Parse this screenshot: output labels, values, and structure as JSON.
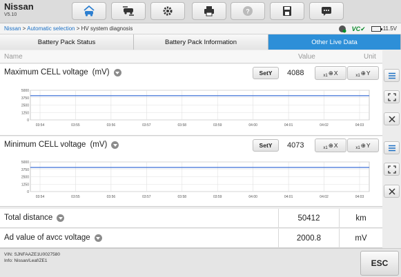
{
  "app": {
    "name": "Nissan",
    "version": "V5.10"
  },
  "toolbar": {
    "icons": [
      "home-car-icon",
      "vehicle-swap-icon",
      "settings-icon",
      "print-icon",
      "help-icon",
      "save-icon",
      "message-icon"
    ]
  },
  "breadcrumb": {
    "link1": "Nissan",
    "sep": " > ",
    "link2": "Automatic selection",
    "current": " > HV system diagnosis"
  },
  "status": {
    "vci": "VC",
    "battery": "11.5V"
  },
  "tabs": [
    "Battery Pack Status",
    "Battery Pack Information",
    "Other Live Data"
  ],
  "active_tab": 2,
  "header": {
    "name": "Name",
    "value": "Value",
    "unit": "Unit"
  },
  "buttons": {
    "sety": "SetY",
    "zoom_x": "X",
    "zoom_y": "Y",
    "zoom_sub": "x1",
    "esc": "ESC"
  },
  "charts": [
    {
      "title": "Maximum CELL voltage",
      "unit": "(mV)",
      "value": "4088",
      "yticks": [
        "5000",
        "3750",
        "2500",
        "1250",
        "0"
      ],
      "xticks": [
        "03:54",
        "03:55",
        "03:56",
        "03:57",
        "03:58",
        "03:59",
        "04:00",
        "04:01",
        "04:02",
        "04:03"
      ],
      "line_value": 4088,
      "ylim": [
        0,
        5000
      ],
      "line_color": "#3b6fd6"
    },
    {
      "title": "Minimum CELL voltage",
      "unit": "(mV)",
      "value": "4073",
      "yticks": [
        "5000",
        "3750",
        "2500",
        "1250",
        "0"
      ],
      "xticks": [
        "03:54",
        "03:55",
        "03:56",
        "03:57",
        "03:58",
        "03:59",
        "04:00",
        "04:01",
        "04:02",
        "04:03"
      ],
      "line_value": 4073,
      "ylim": [
        0,
        5000
      ],
      "line_color": "#3b6fd6"
    }
  ],
  "rows": [
    {
      "name": "Total distance",
      "value": "50412",
      "unit": "km"
    },
    {
      "name": "Ad value of avcc voltage",
      "value": "2000.8",
      "unit": "mV"
    }
  ],
  "footer": {
    "vin": "VIN: SJNFAAZE1U0027580",
    "info": "Info: Nissan/Leaf/ZE1"
  }
}
